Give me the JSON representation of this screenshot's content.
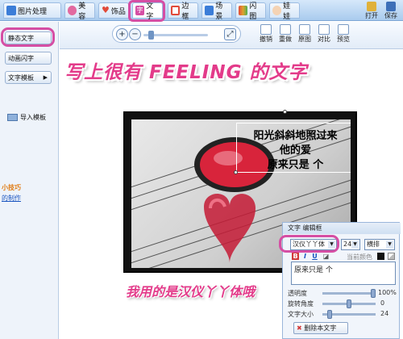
{
  "top_tabs": [
    {
      "label": "图片处理",
      "color": "#3b7dd8"
    },
    {
      "label": "美容",
      "color": "#e26aa0"
    },
    {
      "label": "饰品",
      "color": "#e14b3a"
    },
    {
      "label": "文字",
      "color": "#d54ea4"
    },
    {
      "label": "边框",
      "color": "#e14b3a"
    },
    {
      "label": "场景",
      "color": "#3b7dd8"
    },
    {
      "label": "闪图",
      "color": "#e0a12c"
    },
    {
      "label": "娃娃",
      "color": "#7aa7d8"
    }
  ],
  "top_right": {
    "open": "打开",
    "save": "保存"
  },
  "sidebar": {
    "static_text": "静态文字",
    "animated_text": "动画闪字",
    "text_template": "文字模板",
    "import_template": "导入模板",
    "tip_title": "小技巧",
    "tip_link": "的制作"
  },
  "toolbar": {
    "undo": "撤销",
    "redo": "重做",
    "original": "原图",
    "compare": "对比",
    "preview": "预览"
  },
  "headline": "写上很有 FEELING 的文字",
  "photo_caption": [
    "阳光斜斜地照过来",
    "他的爱",
    "原来只是  个"
  ],
  "panel": {
    "title": "文字 编辑框",
    "font": "汉仪丫丫体",
    "size": "24",
    "orientation": "横排",
    "current_color_label": "当前颜色",
    "text_value": "原来只是  个",
    "opacity_label": "透明度",
    "opacity_value": "100%",
    "rotate_label": "旋转角度",
    "rotate_value": "0",
    "fontsize_label": "文字大小",
    "fontsize_value": "24",
    "delete_label": "删除本文字"
  },
  "note": "我用的是汉仪丫丫体哦",
  "colors": {
    "accent": "#e33b8a",
    "highlight_ring": "#d54ea4"
  }
}
